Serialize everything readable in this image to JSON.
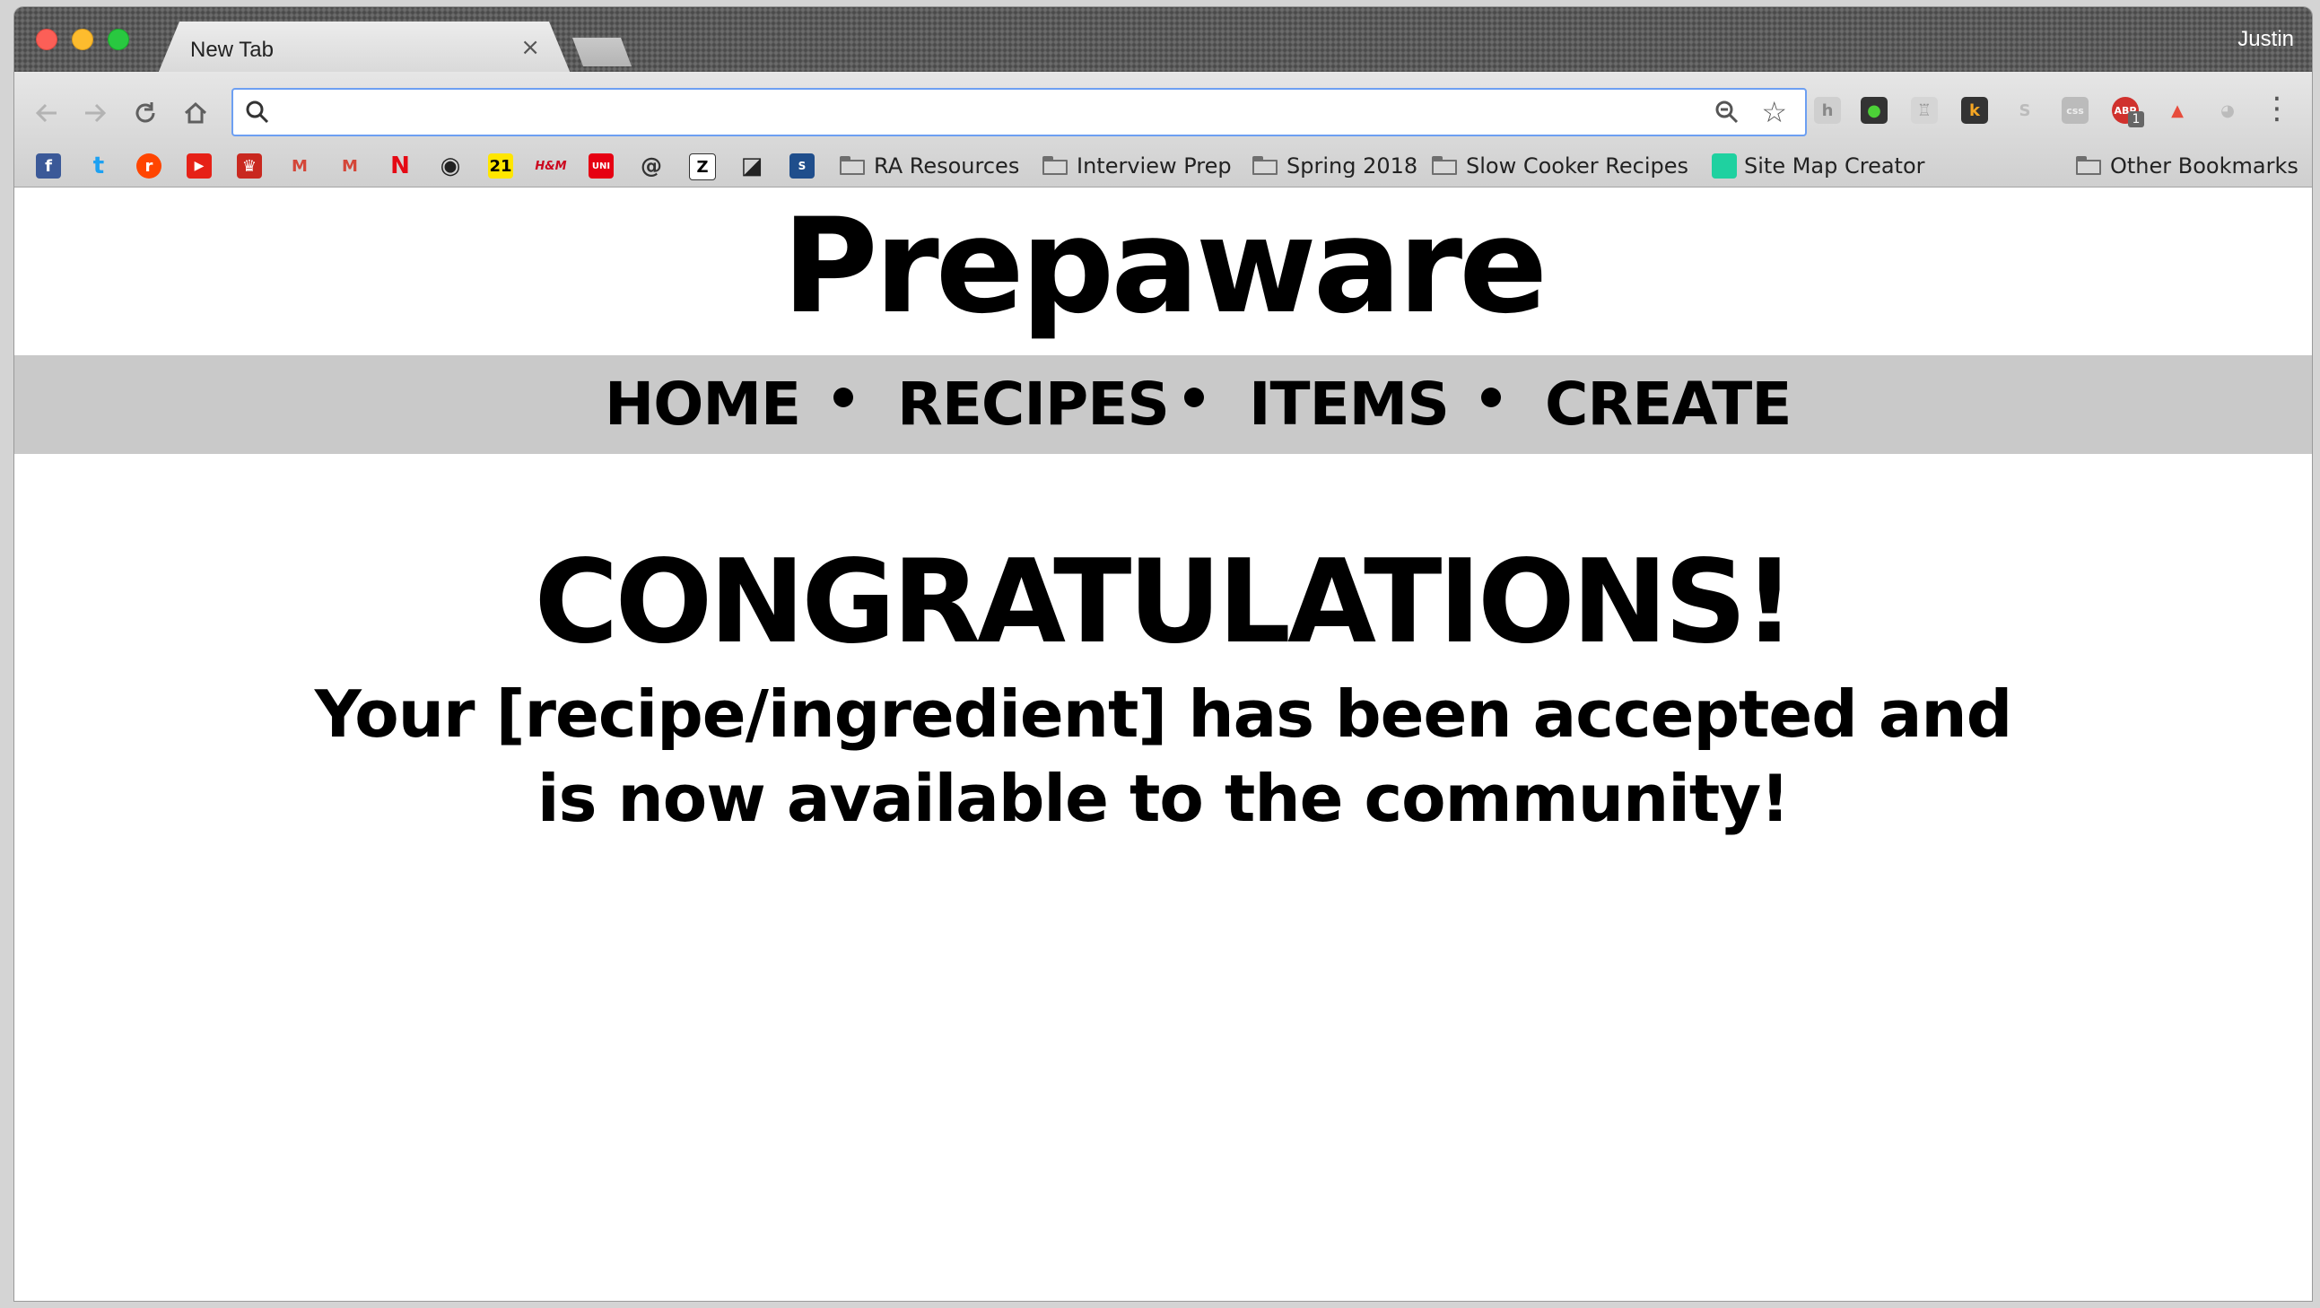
{
  "browser": {
    "tab_title": "New Tab",
    "tab_close": "×",
    "profile_name": "Justin",
    "omnibox": {
      "value": "",
      "placeholder": ""
    },
    "bookmarks": [
      {
        "label": "RA Resources"
      },
      {
        "label": "Interview Prep"
      },
      {
        "label": "Spring 2018"
      },
      {
        "label": "Slow Cooker Recipes"
      },
      {
        "label": "Site Map Creator"
      }
    ],
    "other_bookmarks": "Other Bookmarks",
    "bookmark_favicons": [
      "f",
      "t",
      "r",
      "▶",
      "♛",
      "M",
      "M",
      "N",
      "◉",
      "21",
      "H&M",
      "UNI",
      "@",
      "Z",
      "◪",
      "S"
    ],
    "extensions": [
      "h",
      "●",
      "♖",
      "k",
      "S",
      "css",
      "ABP",
      "▲",
      "◕"
    ],
    "abp_badge": "1"
  },
  "site": {
    "title": "Prepaware",
    "nav": {
      "home": "HOME",
      "recipes": "RECIPES",
      "items": "ITEMS",
      "create": "CREATE"
    },
    "heading": "CONGRATULATIONS!",
    "message_line1": "Your [recipe/ingredient] has been accepted and",
    "message_line2": "is now available to the community!"
  }
}
